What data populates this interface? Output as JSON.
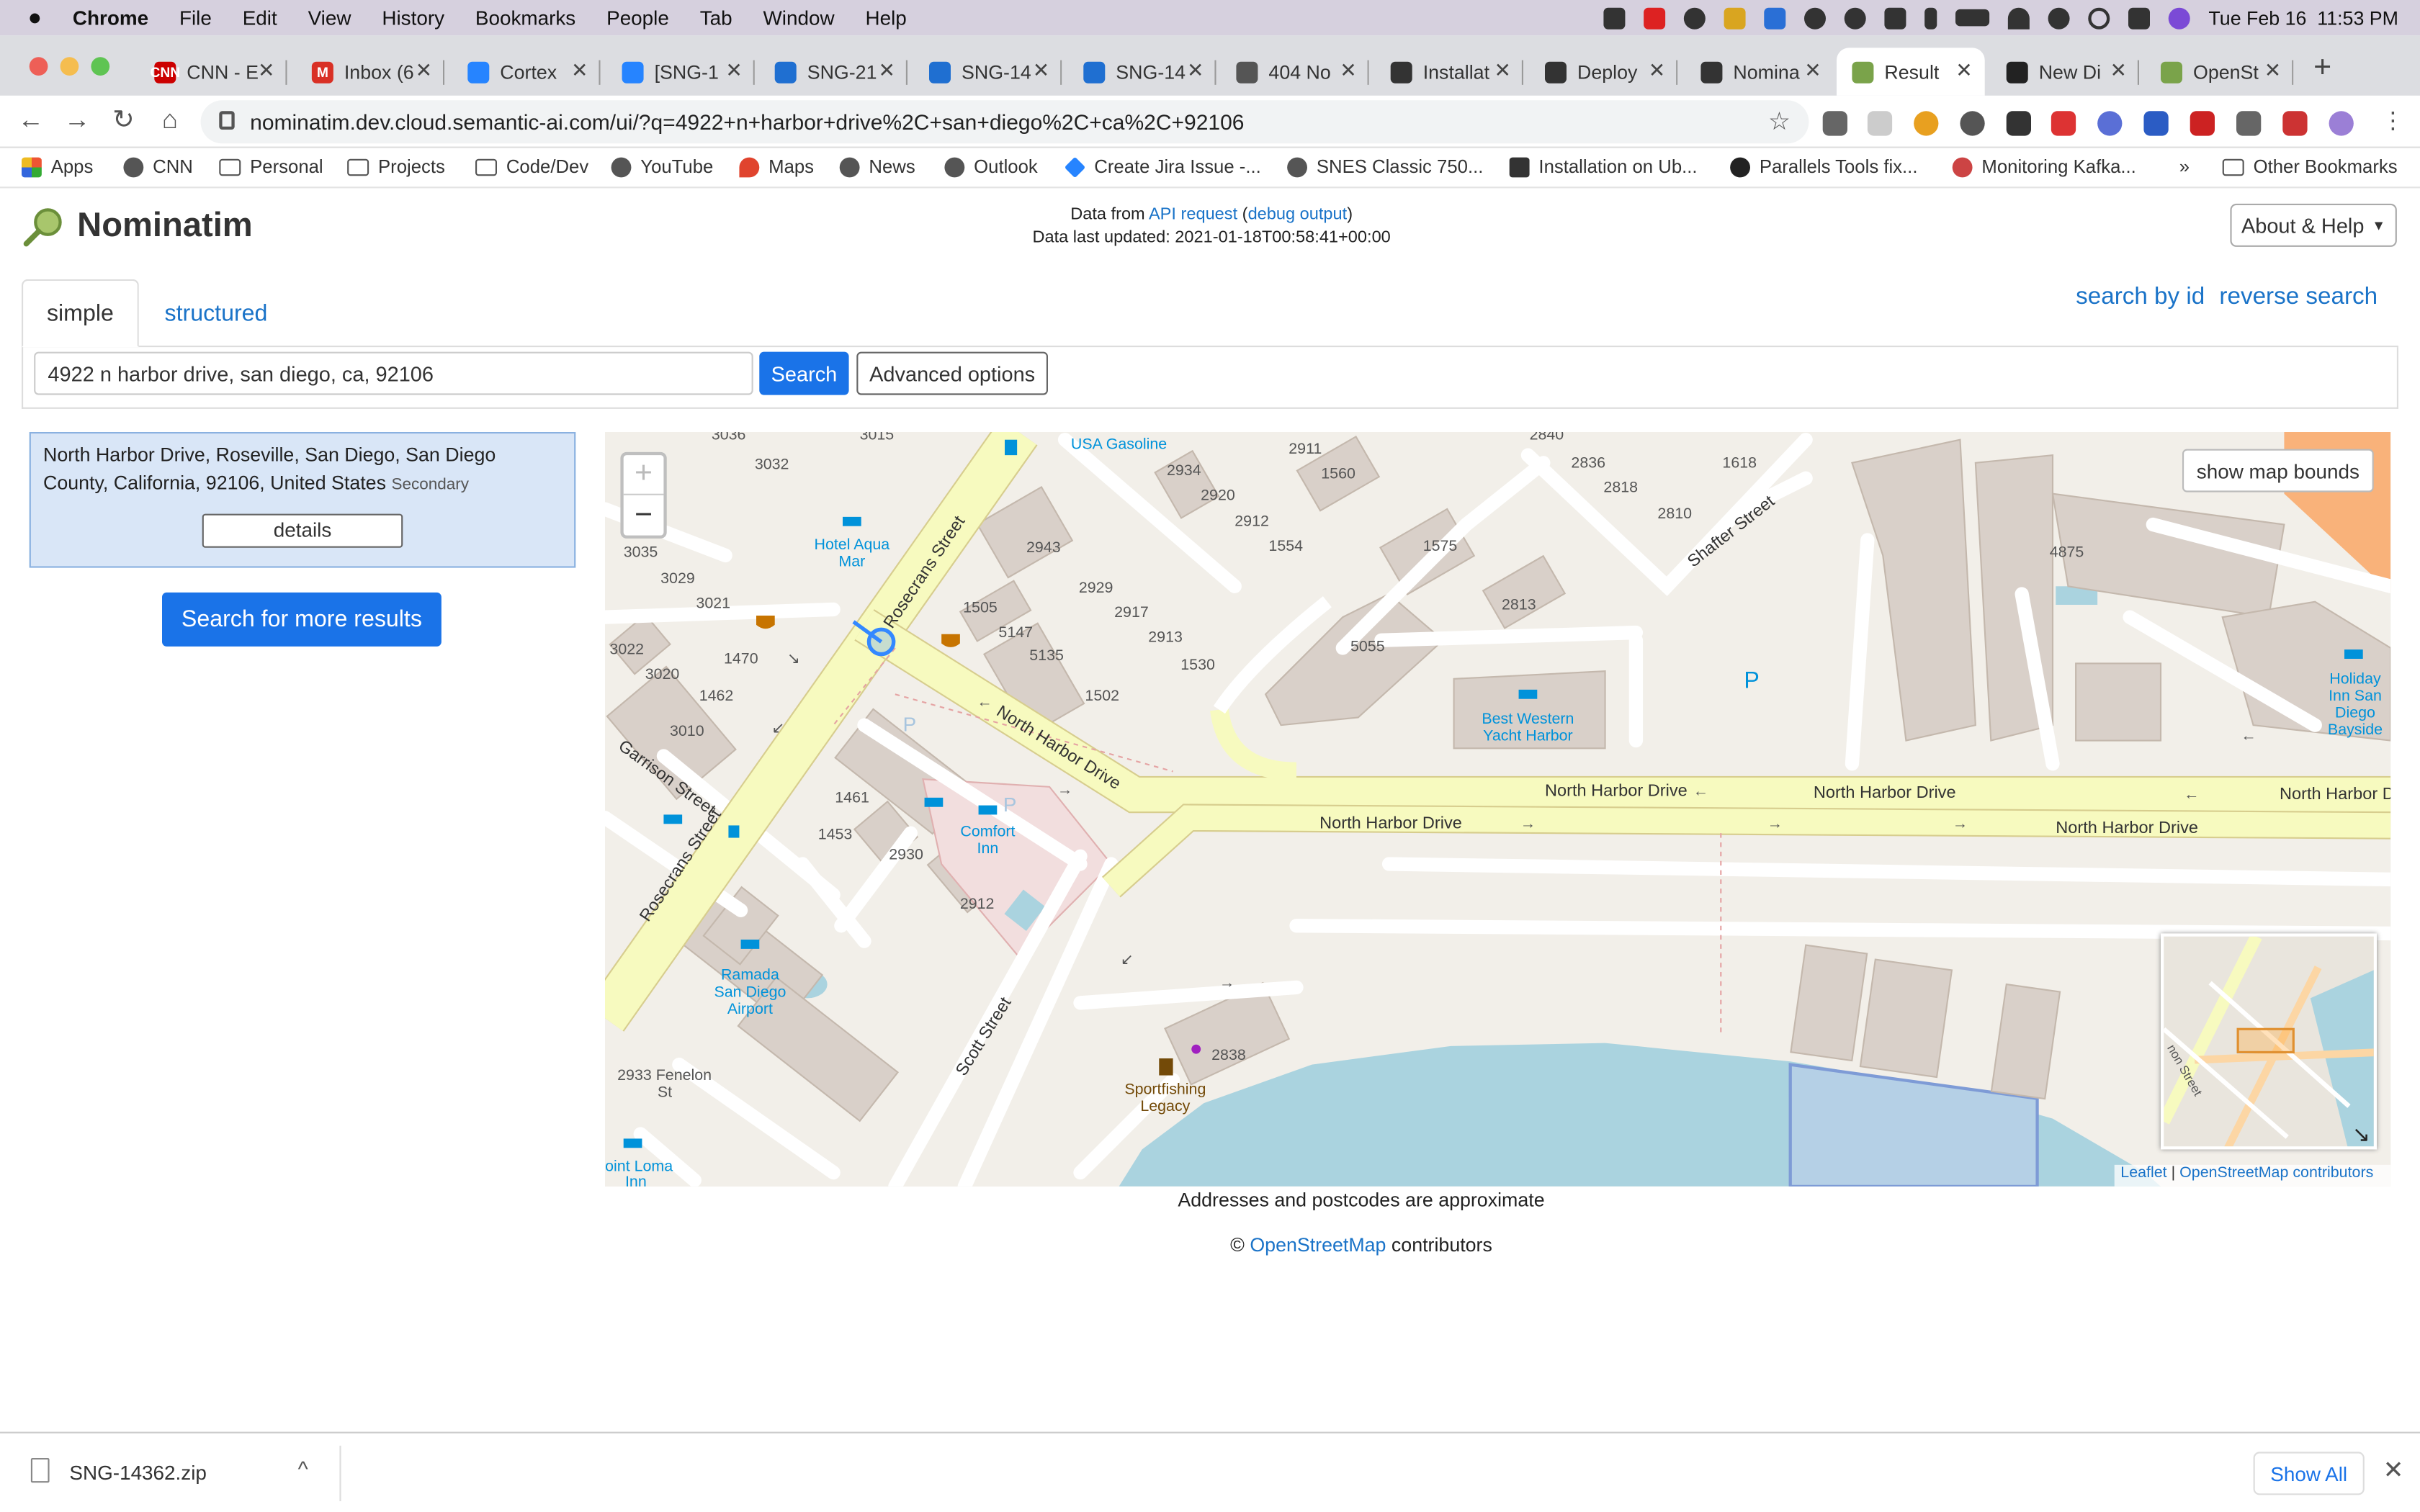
{
  "menubar": {
    "app": "Chrome",
    "items": [
      "File",
      "Edit",
      "View",
      "History",
      "Bookmarks",
      "People",
      "Tab",
      "Window",
      "Help"
    ],
    "datetime": "Tue Feb 16  11:53 PM"
  },
  "tabs": [
    {
      "title": "CNN - E",
      "fav": "#cc0000",
      "favtext": "CNN"
    },
    {
      "title": "Inbox (6",
      "fav": "#d93025",
      "favtext": "M"
    },
    {
      "title": "Cortex",
      "fav": "#2684ff",
      "favtext": ""
    },
    {
      "title": "[SNG-1",
      "fav": "#2684ff",
      "favtext": ""
    },
    {
      "title": "SNG-21",
      "fav": "#1f6fd1",
      "favtext": ""
    },
    {
      "title": "SNG-14",
      "fav": "#1f6fd1",
      "favtext": ""
    },
    {
      "title": "SNG-14",
      "fav": "#1f6fd1",
      "favtext": ""
    },
    {
      "title": "404 No",
      "fav": "#555555",
      "favtext": ""
    },
    {
      "title": "Installat",
      "fav": "#333333",
      "favtext": ""
    },
    {
      "title": "Deploy",
      "fav": "#333333",
      "favtext": ""
    },
    {
      "title": "Nomina",
      "fav": "#333333",
      "favtext": ""
    },
    {
      "title": "Result",
      "fav": "#7aa34a",
      "favtext": ""
    },
    {
      "title": "New Di",
      "fav": "#222222",
      "favtext": ""
    },
    {
      "title": "OpenSt",
      "fav": "#7aa34a",
      "favtext": ""
    }
  ],
  "toolbar": {
    "url": "nominatim.dev.cloud.semantic-ai.com/ui/?q=4922+n+harbor+drive%2C+san+diego%2C+ca%2C+92106"
  },
  "bookmarks": {
    "items": [
      "Apps",
      "CNN",
      "Personal",
      "Projects",
      "Code/Dev",
      "YouTube",
      "Maps",
      "News",
      "Outlook",
      "Create Jira Issue -...",
      "SNES Classic 750...",
      "Installation on Ub...",
      "Parallels Tools fix...",
      "Monitoring Kafka..."
    ],
    "overflow": "»",
    "other": "Other Bookmarks"
  },
  "page": {
    "brand": "Nominatim",
    "data_from": "Data from",
    "api_request": "API request",
    "debug_output": "debug output",
    "last_updated": "Data last updated: 2021-01-18T00:58:41+00:00",
    "about": "About & Help",
    "tab_simple": "simple",
    "tab_structured": "structured",
    "search_by_id": "search by id",
    "reverse_search": "reverse search",
    "query": "4922 n harbor drive, san diego, ca, 92106",
    "search_button": "Search",
    "advanced_button": "Advanced options",
    "result": {
      "name": "North Harbor Drive, Roseville, San Diego, San Diego County, California, 92106, United States",
      "type": "Secondary",
      "details": "details"
    },
    "more_results": "Search for more results",
    "show_map_bounds": "show map bounds",
    "attribution_leaflet": "Leaflet",
    "attribution_sep": " | ",
    "attribution_osm": "OpenStreetMap contributors",
    "approx_note": "Addresses and postcodes are approximate",
    "copyright_symbol": "©",
    "copyright_link": "OpenStreetMap",
    "copyright_tail": "contributors"
  },
  "map": {
    "labels": {
      "north_harbor_1": "North Harbor Drive",
      "north_harbor_2": "North Harbor Drive",
      "north_harbor_3": "North Harbor Drive",
      "north_harbor_4": "North Harbor Drive",
      "north_harbor_5": "North Harbor Dr",
      "north_harbor_diag": "North Harbor Drive",
      "rosecrans_1": "Rosecrans Street",
      "rosecrans_2": "Rosecrans Street",
      "garrison": "Garrison Street",
      "scott": "Scott Street",
      "shafter": "Shafter Street",
      "usa_gasoline": "USA Gasoline",
      "hotel_aqua_1": "Hotel Aqua",
      "hotel_aqua_2": "Mar",
      "best_western_1": "Best Western",
      "best_western_2": "Yacht Harbor",
      "comfort_1": "Comfort",
      "comfort_2": "Inn",
      "ramada_1": "Ramada",
      "ramada_2": "San Diego",
      "ramada_3": "Airport",
      "holiday_1": "Holiday",
      "holiday_2": "Inn San",
      "holiday_3": "Diego",
      "holiday_4": "Bayside",
      "sport_1": "Sportfishing",
      "sport_2": "Legacy",
      "fenelon_1": "2933 Fenelon",
      "fenelon_2": "St",
      "pointloma": "oint Loma",
      "pointloma_2": "Inn",
      "minimap_street": "non Street"
    },
    "numbers": {
      "n3036": "3036",
      "n3015": "3015",
      "n3032": "3032",
      "n3035": "3035",
      "n3029": "3029",
      "n3021": "3021",
      "n3022": "3022",
      "n3020": "3020",
      "n1470": "1470",
      "n1462": "1462",
      "n3010": "3010",
      "n2943": "2943",
      "n1505": "1505",
      "n5147": "5147",
      "n5135": "5135",
      "n1502": "1502",
      "n2929": "2929",
      "n2917": "2917",
      "n2913": "2913",
      "n1530": "1530",
      "n2934": "2934",
      "n2920": "2920",
      "n2912a": "2912",
      "n1554": "1554",
      "n2911": "2911",
      "n1560": "1560",
      "n1575": "1575",
      "n5055": "5055",
      "n2813": "2813",
      "n2840": "2840",
      "n2836": "2836",
      "n2818": "2818",
      "n2810": "2810",
      "n1618": "1618",
      "n4875": "4875",
      "n1461": "1461",
      "n1453": "1453",
      "n2930": "2930",
      "n2912b": "2912",
      "n2838": "2838"
    },
    "symbols": {
      "zoom_in": "+",
      "zoom_out": "−",
      "parking": "P",
      "parking_small": "P"
    }
  },
  "download": {
    "file": "SNG-14362.zip",
    "chevron": "^",
    "show_all": "Show All",
    "close": "✕"
  }
}
